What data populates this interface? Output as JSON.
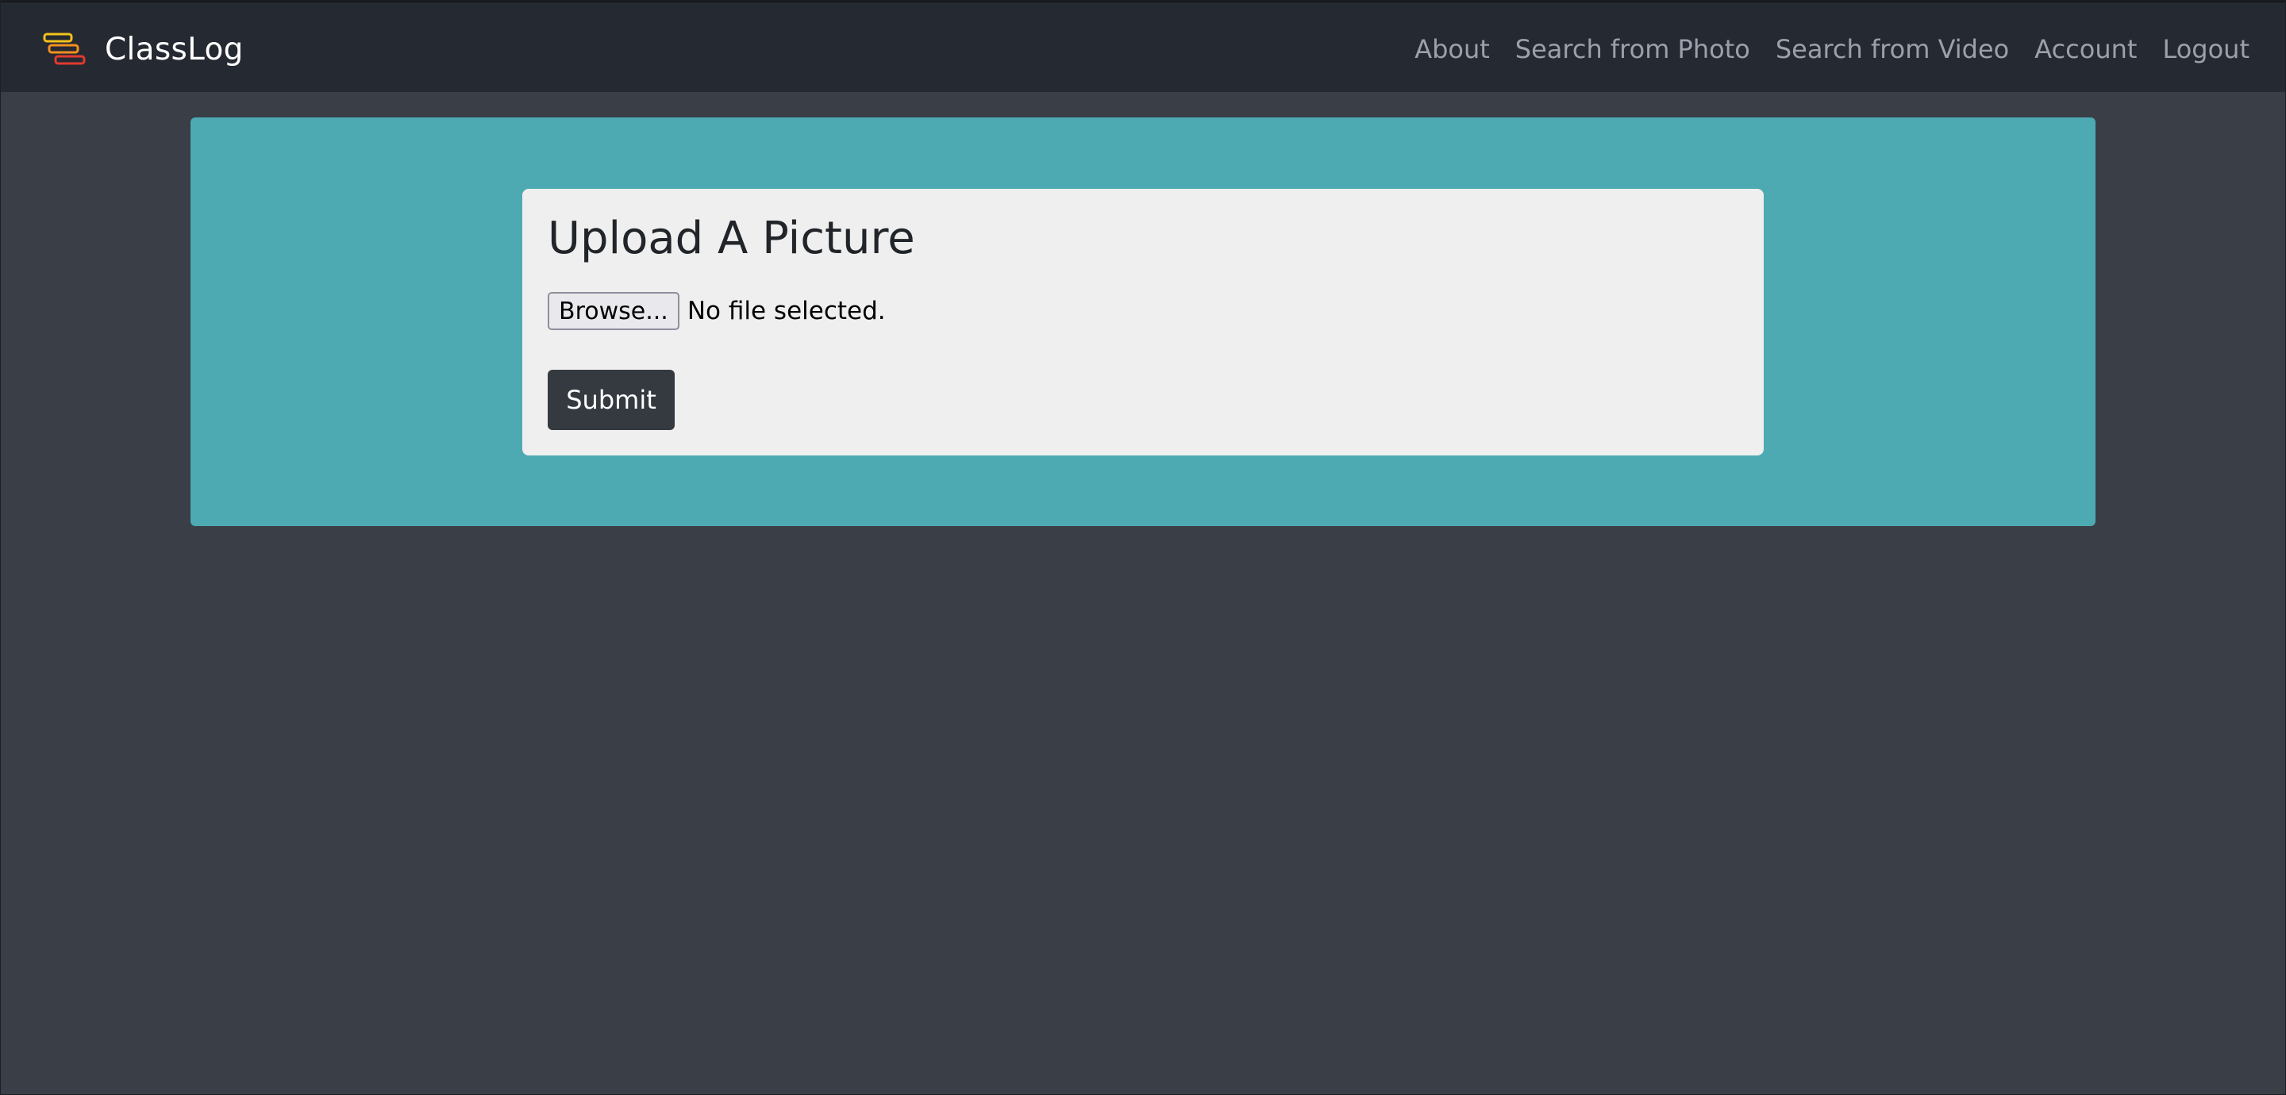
{
  "navbar": {
    "brand": "ClassLog",
    "logo_icon": "stacked-books-icon",
    "links": [
      {
        "label": "About"
      },
      {
        "label": "Search from Photo"
      },
      {
        "label": "Search from Video"
      },
      {
        "label": "Account"
      },
      {
        "label": "Logout"
      }
    ]
  },
  "upload": {
    "title": "Upload A Picture",
    "browse_label": "Browse...",
    "file_status": "No file selected.",
    "submit_label": "Submit"
  },
  "colors": {
    "page_background": "#393e47",
    "navbar_background": "#252932",
    "jumbotron_background": "#4eaab2",
    "card_background": "#efefef",
    "submit_button": "#343a40",
    "nav_link": "#9ba1ab"
  }
}
